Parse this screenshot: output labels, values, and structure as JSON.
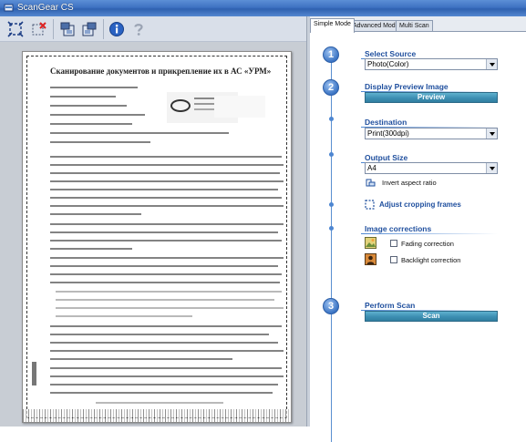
{
  "window": {
    "title": "ScanGear CS"
  },
  "toolbar": {
    "buttons": [
      {
        "name": "auto-crop-button",
        "icon": "auto-crop-icon"
      },
      {
        "name": "clear-crop-button",
        "icon": "clear-crop-icon"
      },
      {
        "name": "rotate-left-button",
        "icon": "rotate-left-icon"
      },
      {
        "name": "rotate-right-button",
        "icon": "rotate-right-icon"
      },
      {
        "name": "info-button",
        "icon": "info-icon"
      },
      {
        "name": "help-button",
        "icon": "help-icon"
      }
    ]
  },
  "preview": {
    "document_title": "Сканирование документов и прикрепление их в АС «УРМ»"
  },
  "tabs": [
    {
      "label": "Simple Mode",
      "active": true
    },
    {
      "label": "Advanced Mode",
      "active": false
    },
    {
      "label": "Multi Scan",
      "active": false
    }
  ],
  "steps": {
    "select_source": {
      "number": "1",
      "title": "Select Source",
      "value": "Photo(Color)"
    },
    "preview_image": {
      "number": "2",
      "title": "Display Preview Image",
      "button": "Preview"
    },
    "destination": {
      "title": "Destination",
      "value": "Print(300dpi)"
    },
    "output_size": {
      "title": "Output Size",
      "value": "A4",
      "invert_label": "Invert aspect ratio"
    },
    "adjust_cropping": {
      "label": "Adjust cropping frames"
    },
    "image_corrections": {
      "title": "Image corrections",
      "fading_label": "Fading correction",
      "backlight_label": "Backlight correction",
      "fading_checked": false,
      "backlight_checked": false
    },
    "perform_scan": {
      "number": "3",
      "title": "Perform Scan",
      "button": "Scan"
    }
  },
  "colors": {
    "accent": "#1f4f9e",
    "button_teal": "#3d8fb3",
    "titlebar": "#3e72c2"
  }
}
